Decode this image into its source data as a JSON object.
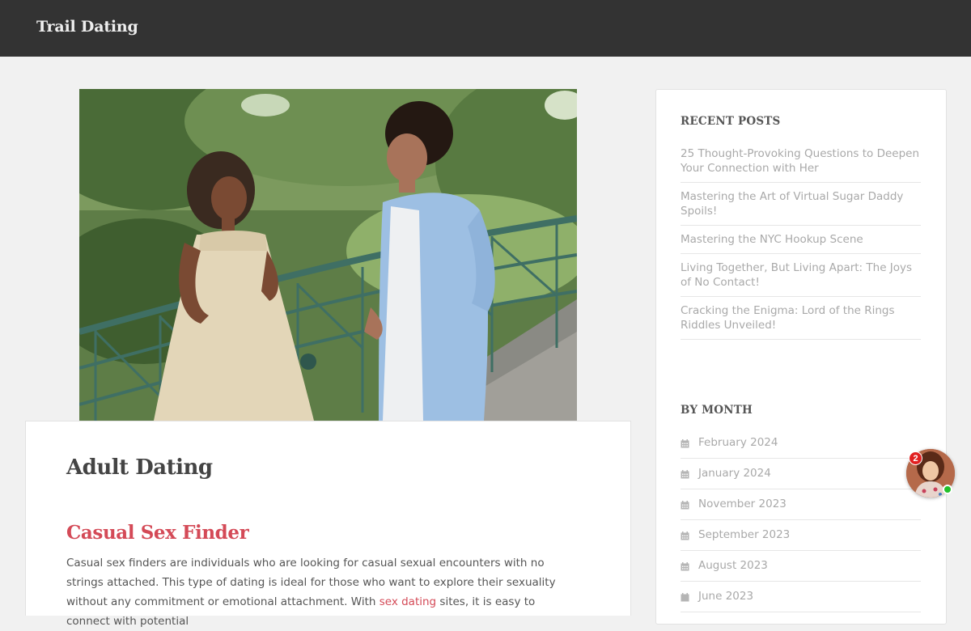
{
  "header": {
    "site_title": "Trail Dating"
  },
  "hero": {
    "image_icon": "couple-photo"
  },
  "article": {
    "title": "Adult Dating",
    "section_heading": "Casual Sex Finder",
    "paragraph_part1": "Casual sex finders are individuals who are looking for casual sexual encounters with no strings attached. This type of dating is ideal for those who want to explore their sexuality without any commitment or emotional attachment. With ",
    "paragraph_link": "sex dating",
    "paragraph_part2": " sites, it is easy to connect with potential"
  },
  "sidebar": {
    "recent_title": "RECENT POSTS",
    "recent_posts": [
      "25 Thought-Provoking Questions to Deepen Your Connection with Her",
      "Mastering the Art of Virtual Sugar Daddy Spoils!",
      "Mastering the NYC Hookup Scene",
      "Living Together, But Living Apart: The Joys of No Contact!",
      "Cracking the Enigma: Lord of the Rings Riddles Unveiled!"
    ],
    "month_title": "BY MONTH",
    "months": [
      "February 2024",
      "January 2024",
      "November 2023",
      "September 2023",
      "August 2023",
      "June 2023"
    ],
    "icon": "calendar-icon"
  },
  "chat": {
    "badge_count": "2",
    "icon": "chat-avatar"
  },
  "colors": {
    "header_bg": "#333333",
    "accent": "#d44a57",
    "page_bg": "#f1f1f1",
    "link_gray": "#a9a9a9"
  }
}
